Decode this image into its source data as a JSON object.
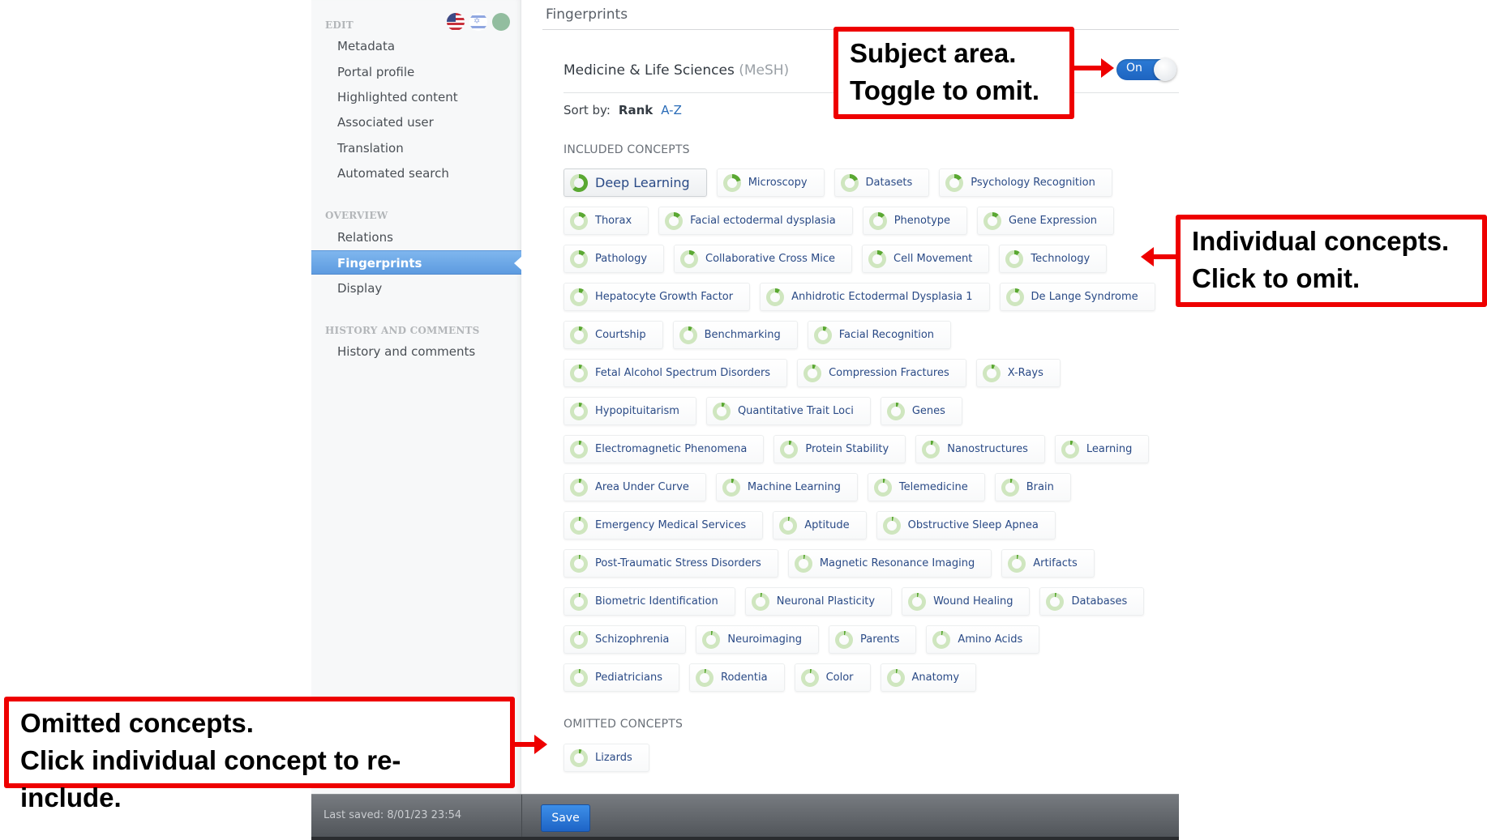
{
  "sidebar": {
    "sections": [
      {
        "title": "EDIT",
        "items": [
          {
            "label": "Metadata"
          },
          {
            "label": "Portal profile"
          },
          {
            "label": "Highlighted content"
          },
          {
            "label": "Associated user"
          },
          {
            "label": "Translation"
          },
          {
            "label": "Automated search"
          }
        ]
      },
      {
        "title": "OVERVIEW",
        "items": [
          {
            "label": "Relations"
          },
          {
            "label": "Fingerprints",
            "active": true
          },
          {
            "label": "Display"
          }
        ]
      },
      {
        "title": "HISTORY AND COMMENTS",
        "items": [
          {
            "label": "History and comments"
          }
        ]
      }
    ],
    "language_icons": [
      "us-flag-icon",
      "israel-flag-icon",
      "status-circle-icon"
    ]
  },
  "main": {
    "title": "Fingerprints",
    "subject_area": {
      "name": "Medicine & Life Sciences",
      "scheme": "(MeSH)",
      "toggle_label": "On",
      "toggle_state": "on"
    },
    "sort": {
      "label": "Sort by:",
      "options": [
        "Rank",
        "A-Z"
      ],
      "selected": "Rank"
    },
    "included_label": "INCLUDED CONCEPTS",
    "included_concepts": [
      {
        "label": "Deep Learning",
        "weight": 0.62
      },
      {
        "label": "Microscopy",
        "weight": 0.2
      },
      {
        "label": "Datasets",
        "weight": 0.18
      },
      {
        "label": "Psychology Recognition",
        "weight": 0.15
      },
      {
        "label": "Thorax",
        "weight": 0.14
      },
      {
        "label": "Facial ectodermal dysplasia",
        "weight": 0.13
      },
      {
        "label": "Phenotype",
        "weight": 0.13
      },
      {
        "label": "Gene Expression",
        "weight": 0.12
      },
      {
        "label": "Pathology",
        "weight": 0.12
      },
      {
        "label": "Collaborative Cross Mice",
        "weight": 0.11
      },
      {
        "label": "Cell Movement",
        "weight": 0.11
      },
      {
        "label": "Technology",
        "weight": 0.1
      },
      {
        "label": "Hepatocyte Growth Factor",
        "weight": 0.09
      },
      {
        "label": "Anhidrotic Ectodermal Dysplasia 1",
        "weight": 0.09
      },
      {
        "label": "De Lange Syndrome",
        "weight": 0.08
      },
      {
        "label": "Courtship",
        "weight": 0.07
      },
      {
        "label": "Benchmarking",
        "weight": 0.07
      },
      {
        "label": "Facial Recognition",
        "weight": 0.07
      },
      {
        "label": "Fetal Alcohol Spectrum Disorders",
        "weight": 0.06
      },
      {
        "label": "Compression Fractures",
        "weight": 0.06
      },
      {
        "label": "X-Rays",
        "weight": 0.06
      },
      {
        "label": "Hypopituitarism",
        "weight": 0.06
      },
      {
        "label": "Quantitative Trait Loci",
        "weight": 0.06
      },
      {
        "label": "Genes",
        "weight": 0.05
      },
      {
        "label": "Electromagnetic Phenomena",
        "weight": 0.05
      },
      {
        "label": "Protein Stability",
        "weight": 0.05
      },
      {
        "label": "Nanostructures",
        "weight": 0.05
      },
      {
        "label": "Learning",
        "weight": 0.05
      },
      {
        "label": "Area Under Curve",
        "weight": 0.05
      },
      {
        "label": "Machine Learning",
        "weight": 0.05
      },
      {
        "label": "Telemedicine",
        "weight": 0.04
      },
      {
        "label": "Brain",
        "weight": 0.04
      },
      {
        "label": "Emergency Medical Services",
        "weight": 0.04
      },
      {
        "label": "Aptitude",
        "weight": 0.03
      },
      {
        "label": "Obstructive Sleep Apnea",
        "weight": 0.03
      },
      {
        "label": "Post-Traumatic Stress Disorders",
        "weight": 0.03
      },
      {
        "label": "Magnetic Resonance Imaging",
        "weight": 0.03
      },
      {
        "label": "Artifacts",
        "weight": 0.03
      },
      {
        "label": "Biometric Identification",
        "weight": 0.03
      },
      {
        "label": "Neuronal Plasticity",
        "weight": 0.03
      },
      {
        "label": "Wound Healing",
        "weight": 0.03
      },
      {
        "label": "Databases",
        "weight": 0.03
      },
      {
        "label": "Schizophrenia",
        "weight": 0.03
      },
      {
        "label": "Neuroimaging",
        "weight": 0.03
      },
      {
        "label": "Parents",
        "weight": 0.03
      },
      {
        "label": "Amino Acids",
        "weight": 0.03
      },
      {
        "label": "Pediatricians",
        "weight": 0.03
      },
      {
        "label": "Rodentia",
        "weight": 0.03
      },
      {
        "label": "Color",
        "weight": 0.03
      },
      {
        "label": "Anatomy",
        "weight": 0.03
      }
    ],
    "omitted_label": "OMITTED CONCEPTS",
    "omitted_concepts": [
      {
        "label": "Lizards",
        "weight": 0.05
      }
    ],
    "ring_colors": {
      "filled": "#5aa832",
      "track": "#cfe6bf"
    }
  },
  "footer": {
    "last_saved": "Last saved: 8/01/23 23:54",
    "save_label": "Save"
  },
  "annotations": {
    "subject": [
      "Subject area.",
      "Toggle to omit."
    ],
    "concepts": [
      "Individual concepts.",
      "Click to omit."
    ],
    "omitted": [
      "Omitted concepts.",
      "Click individual concept to re-include."
    ]
  }
}
